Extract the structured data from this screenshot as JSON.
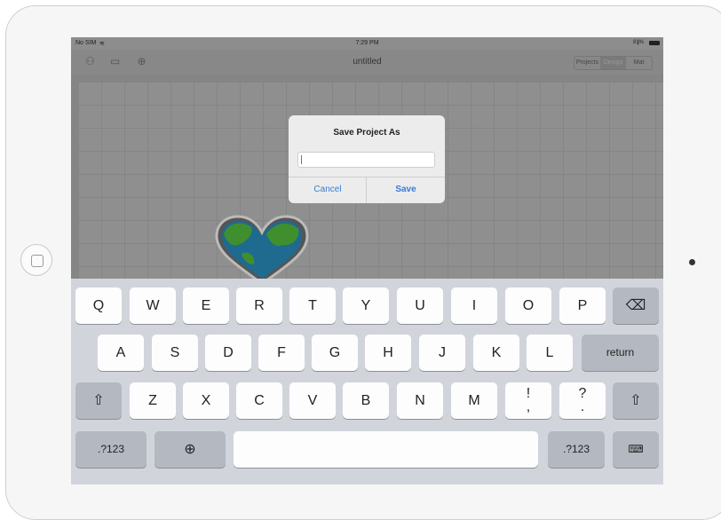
{
  "status": {
    "carrier": "No SIM",
    "time": "7:29 PM",
    "battery": "81%"
  },
  "toolbar": {
    "title": "untitled",
    "tabs": [
      "Projects",
      "Design",
      "Mat"
    ],
    "selected_tab": "Design"
  },
  "dialog": {
    "title": "Save Project As",
    "input_value": "",
    "cancel_label": "Cancel",
    "save_label": "Save",
    "accent": "#3a7bd5"
  },
  "keyboard": {
    "row1": [
      "Q",
      "W",
      "E",
      "R",
      "T",
      "Y",
      "U",
      "I",
      "O",
      "P"
    ],
    "row2": [
      "A",
      "S",
      "D",
      "F",
      "G",
      "H",
      "J",
      "K",
      "L"
    ],
    "row2_return": "return",
    "row3": [
      "Z",
      "X",
      "C",
      "V",
      "B",
      "N",
      "M"
    ],
    "row3_punct": [
      "!\n,",
      "?\n."
    ],
    "row4_numbers_left": ".?123",
    "row4_numbers_right": ".?123"
  }
}
